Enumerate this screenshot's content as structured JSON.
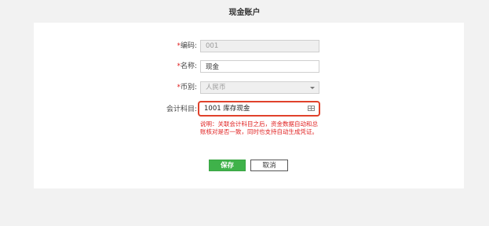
{
  "page": {
    "title": "现金账户"
  },
  "form": {
    "required_mark": "*",
    "code": {
      "label": "编码:",
      "value": "001",
      "disabled": true
    },
    "name": {
      "label": "名称:",
      "value": "现金"
    },
    "currency": {
      "label": "币别:",
      "value": "人民币",
      "disabled": true
    },
    "account_subject": {
      "label": "会计科目:",
      "value": "1001 库存现金",
      "icon": "grid-icon",
      "highlight_color": "#e0412b"
    },
    "note": "说明：关联会计科目之后，资金数据自动和总账核对是否一致，同时也支持自动生成凭证。"
  },
  "actions": {
    "save_label": "保存",
    "cancel_label": "取消"
  },
  "colors": {
    "background": "#f2f2f2",
    "primary": "#3fb24a",
    "required": "#e02020",
    "highlight": "#e0412b"
  }
}
